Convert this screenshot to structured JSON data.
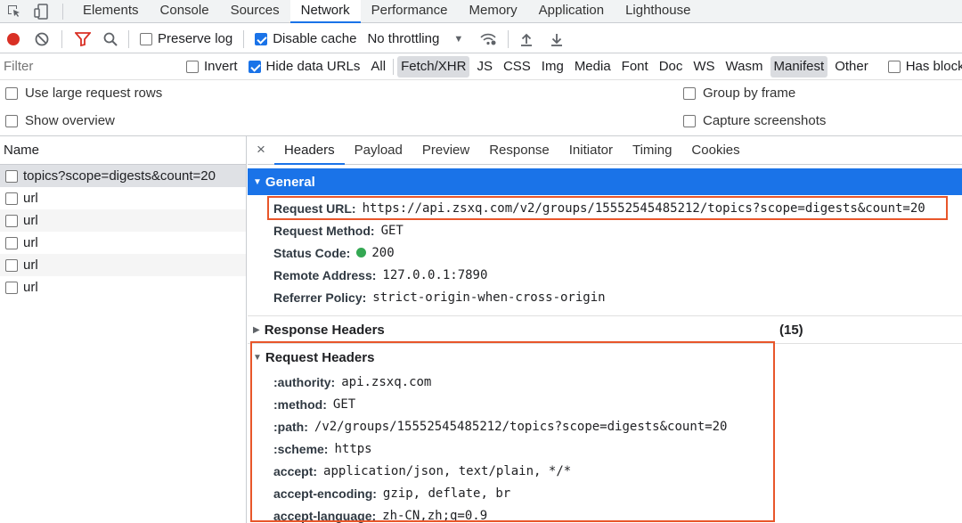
{
  "tabs": [
    "Elements",
    "Console",
    "Sources",
    "Network",
    "Performance",
    "Memory",
    "Application",
    "Lighthouse"
  ],
  "toolbar": {
    "preserve_log": "Preserve log",
    "disable_cache": "Disable cache",
    "throttling": "No throttling"
  },
  "filter": {
    "placeholder": "Filter",
    "invert": "Invert",
    "hide_data_urls": "Hide data URLs",
    "types": [
      "All",
      "Fetch/XHR",
      "JS",
      "CSS",
      "Img",
      "Media",
      "Font",
      "Doc",
      "WS",
      "Wasm",
      "Manifest",
      "Other"
    ],
    "has_blocked": "Has blocked c"
  },
  "options": {
    "large_rows": "Use large request rows",
    "overview": "Show overview",
    "group_by_frame": "Group by frame",
    "capture_screenshots": "Capture screenshots"
  },
  "list": {
    "header": "Name",
    "rows": [
      "topics?scope=digests&count=20",
      "url",
      "url",
      "url",
      "url",
      "url"
    ]
  },
  "detail": {
    "tabs": [
      "Headers",
      "Payload",
      "Preview",
      "Response",
      "Initiator",
      "Timing",
      "Cookies"
    ],
    "general": {
      "title": "General",
      "rows": [
        {
          "k": "Request URL:",
          "v": "https://api.zsxq.com/v2/groups/15552545485212/topics?scope=digests&count=20"
        },
        {
          "k": "Request Method:",
          "v": "GET"
        },
        {
          "k": "Status Code:",
          "v": "200"
        },
        {
          "k": "Remote Address:",
          "v": "127.0.0.1:7890"
        },
        {
          "k": "Referrer Policy:",
          "v": "strict-origin-when-cross-origin"
        }
      ]
    },
    "response_headers": {
      "title": "Response Headers",
      "count": "(15)"
    },
    "request_headers": {
      "title": "Request Headers",
      "rows": [
        {
          "k": ":authority:",
          "v": "api.zsxq.com"
        },
        {
          "k": ":method:",
          "v": "GET"
        },
        {
          "k": ":path:",
          "v": "/v2/groups/15552545485212/topics?scope=digests&count=20"
        },
        {
          "k": ":scheme:",
          "v": "https"
        },
        {
          "k": "accept:",
          "v": "application/json, text/plain, */*"
        },
        {
          "k": "accept-encoding:",
          "v": "gzip, deflate, br"
        },
        {
          "k": "accept-language:",
          "v": "zh-CN,zh;q=0.9"
        }
      ]
    }
  },
  "colors": {
    "accent": "#1a73e8",
    "highlight_box": "#e8562a",
    "record": "#d93025",
    "status_ok": "#34a853"
  }
}
